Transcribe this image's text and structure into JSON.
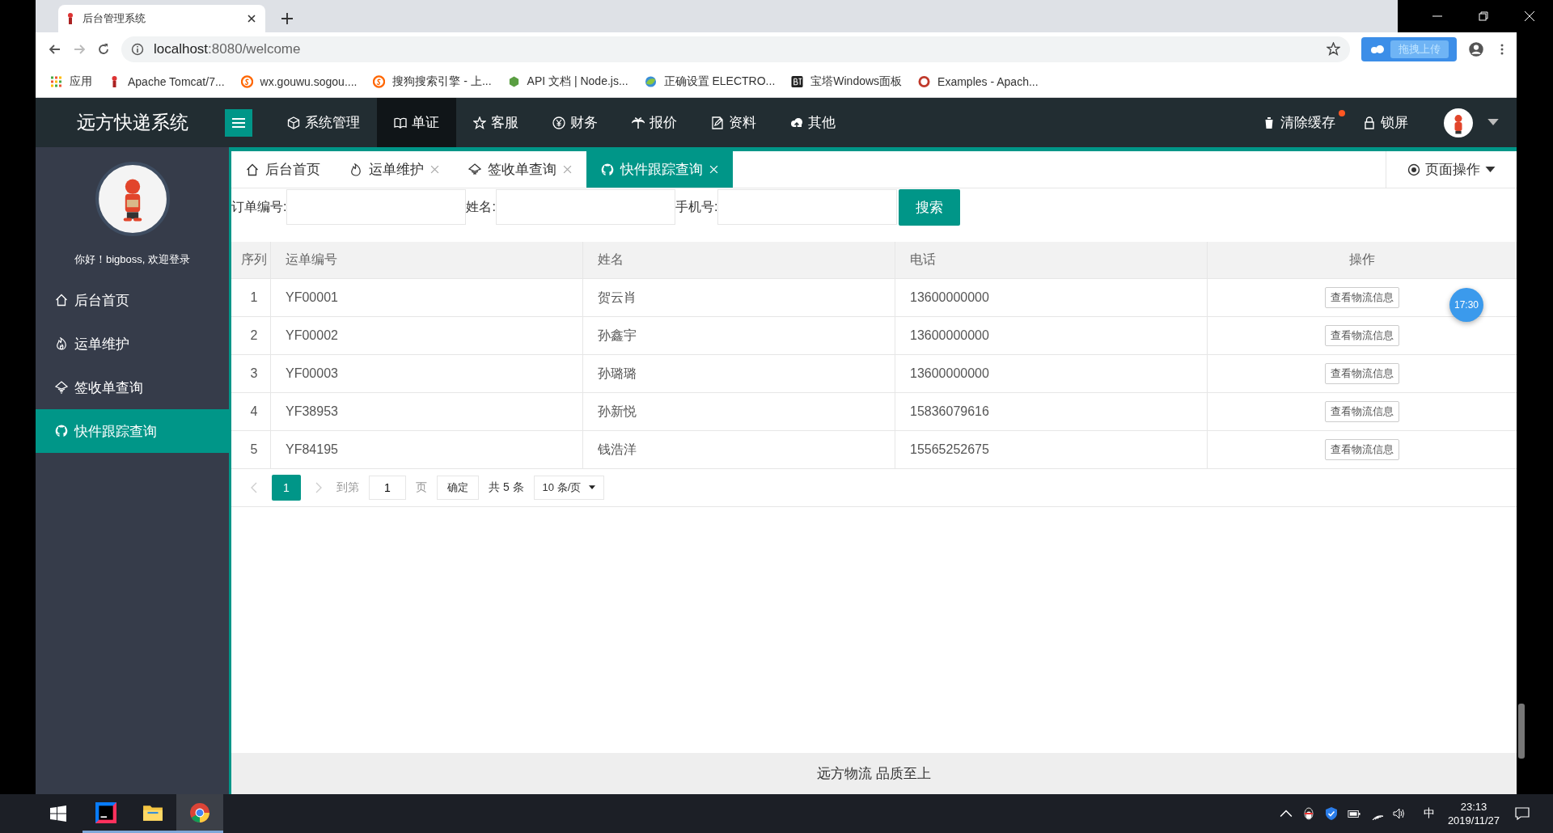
{
  "browser": {
    "tab_title": "后台管理系统",
    "url_host": "localhost",
    "url_path": ":8080/welcome",
    "upload_widget": "拖拽上传",
    "bookmarks": [
      {
        "label": "应用",
        "kind": "apps"
      },
      {
        "label": "Apache Tomcat/7...",
        "kind": "figure"
      },
      {
        "label": "wx.gouwu.sogou....",
        "kind": "sogou"
      },
      {
        "label": "搜狗搜索引擎 - 上...",
        "kind": "sogou"
      },
      {
        "label": "API 文档 | Node.js...",
        "kind": "hex"
      },
      {
        "label": "正确设置 ELECTRO...",
        "kind": "globe"
      },
      {
        "label": "宝塔Windows面板",
        "kind": "bt"
      },
      {
        "label": "Examples - Apach...",
        "kind": "ring"
      }
    ]
  },
  "header": {
    "brand": "远方快递系统",
    "nav": [
      {
        "label": "系统管理",
        "selected": false
      },
      {
        "label": "单证",
        "selected": true
      },
      {
        "label": "客服",
        "selected": false
      },
      {
        "label": "财务",
        "selected": false
      },
      {
        "label": "报价",
        "selected": false
      },
      {
        "label": "资料",
        "selected": false
      },
      {
        "label": "其他",
        "selected": false
      }
    ],
    "clear_cache": {
      "label": "清除缓存",
      "dot": true
    },
    "lock": "锁屏"
  },
  "sidebar": {
    "greeting": "你好！bigboss, 欢迎登录",
    "items": [
      {
        "label": "后台首页",
        "selected": false
      },
      {
        "label": "运单维护",
        "selected": false
      },
      {
        "label": "签收单查询",
        "selected": false
      },
      {
        "label": "快件跟踪查询",
        "selected": true
      }
    ]
  },
  "tabs": [
    {
      "label": "后台首页",
      "closable": false,
      "selected": false
    },
    {
      "label": "运单维护",
      "closable": true,
      "selected": false
    },
    {
      "label": "签收单查询",
      "closable": true,
      "selected": false
    },
    {
      "label": "快件跟踪查询",
      "closable": true,
      "selected": true
    }
  ],
  "page_ops": "页面操作",
  "search": {
    "fields": [
      {
        "label": "订单编号:"
      },
      {
        "label": "姓名:"
      },
      {
        "label": "手机号:"
      }
    ],
    "button": "搜索"
  },
  "table": {
    "columns": [
      "序列",
      "运单编号",
      "姓名",
      "电话",
      "操作"
    ],
    "rows": [
      {
        "index": "1",
        "waybill": "YF00001",
        "name": "贺云肖",
        "phone": "13600000000",
        "action": "查看物流信息"
      },
      {
        "index": "2",
        "waybill": "YF00002",
        "name": "孙鑫宇",
        "phone": "13600000000",
        "action": "查看物流信息"
      },
      {
        "index": "3",
        "waybill": "YF00003",
        "name": "孙璐璐",
        "phone": "13600000000",
        "action": "查看物流信息"
      },
      {
        "index": "4",
        "waybill": "YF38953",
        "name": "孙新悦",
        "phone": "15836079616",
        "action": "查看物流信息"
      },
      {
        "index": "5",
        "waybill": "YF84195",
        "name": "钱浩洋",
        "phone": "15565252675",
        "action": "查看物流信息"
      }
    ]
  },
  "pagination": {
    "pages": [
      {
        "label": "1",
        "selected": true
      }
    ],
    "goto": "到第",
    "page_input": "1",
    "page_unit": "页",
    "confirm": "确定",
    "total": "共 5 条",
    "page_size": "10 条/页"
  },
  "floating_badge": "17:30",
  "footer": "远方物流 品质至上",
  "taskbar": {
    "apps": [
      {
        "kind": "idea",
        "selected": false
      },
      {
        "kind": "folder",
        "selected": false
      },
      {
        "kind": "chrome",
        "selected": true
      }
    ],
    "ime": "中",
    "time": "23:13",
    "date": "2019/11/27"
  }
}
